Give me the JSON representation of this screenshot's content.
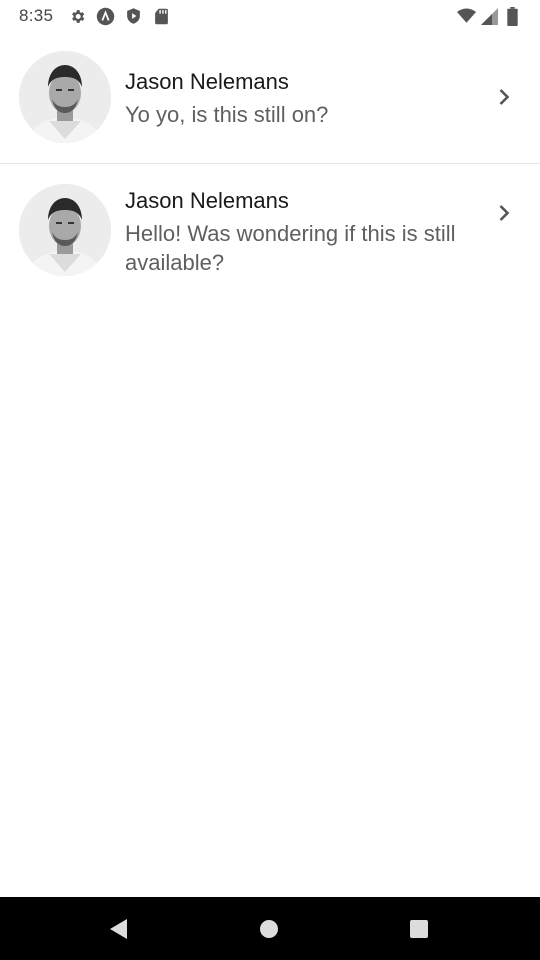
{
  "status_bar": {
    "time": "8:35",
    "left_icons": [
      "gear-icon",
      "assistant-a-icon",
      "shield-play-icon",
      "sd-card-icon"
    ],
    "right_icons": [
      "wifi-icon",
      "cell-signal-icon",
      "battery-icon"
    ]
  },
  "conversations": [
    {
      "name": "Jason Nelemans",
      "preview": "Yo yo, is this still on?",
      "avatar": "profile-photo",
      "action_icon": "chevron-right-icon"
    },
    {
      "name": "Jason Nelemans",
      "preview": "Hello! Was wondering if this is still available?",
      "avatar": "profile-photo",
      "action_icon": "chevron-right-icon"
    }
  ],
  "nav_bar": {
    "buttons": [
      "back-icon",
      "home-icon",
      "recents-icon"
    ]
  },
  "colors": {
    "name_text": "#1a1a1a",
    "preview_text": "#5f5f5f",
    "divider": "#e6e6e6",
    "nav_bar_bg": "#000000",
    "status_icons": "#555555"
  }
}
